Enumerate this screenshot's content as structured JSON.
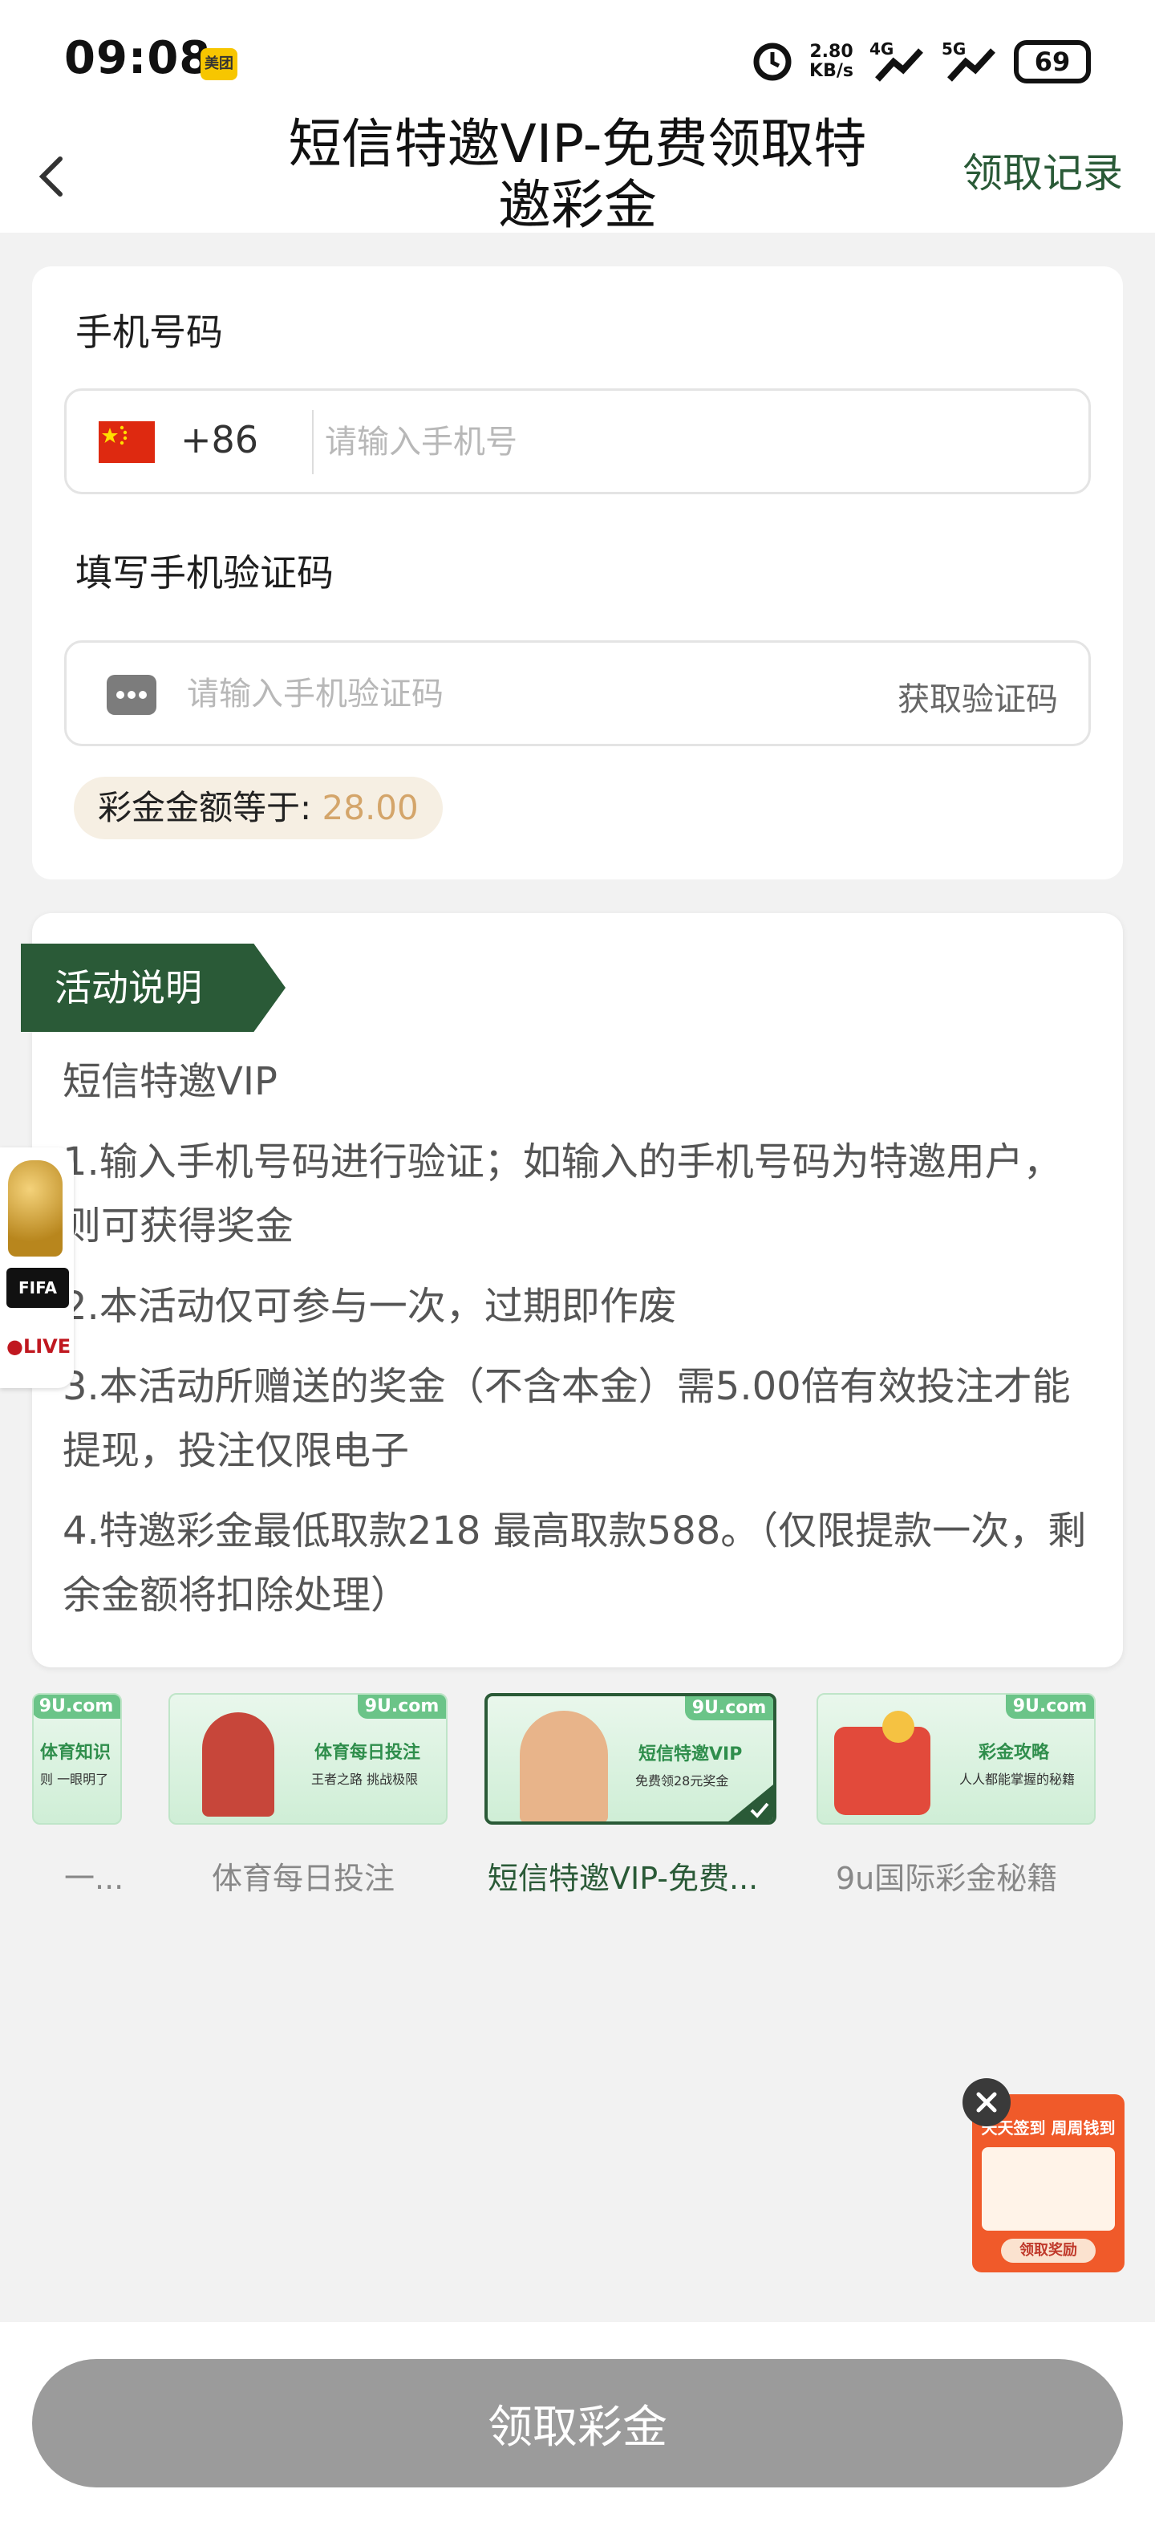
{
  "status_bar": {
    "time": "09:08",
    "app_badge": "美团",
    "speed_value": "2.80",
    "speed_unit": "KB/s",
    "net1": "4G",
    "net2": "5G",
    "battery": "69"
  },
  "header": {
    "title": "短信特邀VIP-免费领取特邀彩金",
    "record_link": "领取记录"
  },
  "form": {
    "phone_label": "手机号码",
    "country_code": "+86",
    "phone_placeholder": "请输入手机号",
    "code_label": "填写手机验证码",
    "code_placeholder": "请输入手机验证码",
    "get_code": "获取验证码",
    "amount_label": "彩金金额等于: ",
    "amount_value": "28.00"
  },
  "activity": {
    "tag": "活动说明",
    "title": "短信特邀VIP",
    "rules": [
      "1.输入手机号码进行验证；如输入的手机号码为特邀用户，则可获得奖金",
      "2.本活动仅可参与一次，过期即作废",
      "3.本活动所赠送的奖金（不含本金）需5.00倍有效投注才能提现，投注仅限电子",
      "4.特邀彩金最低取款218  最高取款588。（仅限提款一次，剩余金额将扣除处理）"
    ]
  },
  "floating": {
    "fifa": "FIFA",
    "live": "●LIVE"
  },
  "banners": [
    {
      "caption": "一...",
      "ribbon": "9U.com",
      "head": "体育知识",
      "sub": "则 一眼明了"
    },
    {
      "caption": "体育每日投注",
      "ribbon": "9U.com",
      "head": "体育每日投注",
      "sub": "王者之路 挑战极限"
    },
    {
      "caption": "短信特邀VIP-免费...",
      "ribbon": "9U.com",
      "head": "短信特邀VIP",
      "sub": "免费领28元奖金"
    },
    {
      "caption": "9u国际彩金秘籍",
      "ribbon": "9U.com",
      "head": "彩金攻略",
      "sub": "人人都能掌握的秘籍"
    }
  ],
  "sign_widget": {
    "title": "天天签到 周周钱到",
    "button": "领取奖励"
  },
  "bottom": {
    "claim_button": "领取彩金"
  }
}
